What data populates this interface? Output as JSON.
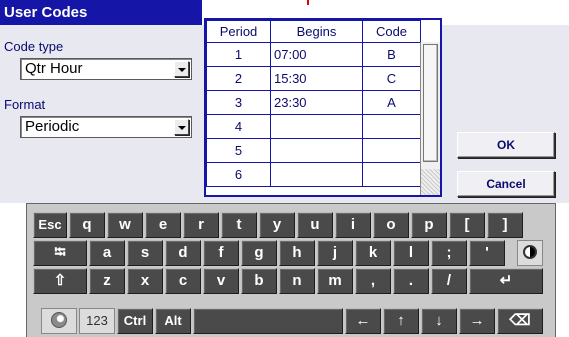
{
  "window": {
    "title": "User Codes"
  },
  "code_type": {
    "label": "Code type",
    "value": "Qtr Hour"
  },
  "format": {
    "label": "Format",
    "value": "Periodic"
  },
  "table": {
    "headers": [
      "Period",
      "Begins",
      "Code"
    ],
    "rows": [
      [
        "1",
        "07:00",
        "B"
      ],
      [
        "2",
        "15:30",
        "C"
      ],
      [
        "3",
        "23:30",
        "A"
      ],
      [
        "4",
        "",
        ""
      ],
      [
        "5",
        "",
        ""
      ],
      [
        "6",
        "",
        ""
      ]
    ]
  },
  "buttons": {
    "ok": "OK",
    "cancel": "Cancel"
  },
  "keyboard": {
    "row1": [
      "Esc",
      "q",
      "w",
      "e",
      "r",
      "t",
      "y",
      "u",
      "i",
      "o",
      "p",
      "[",
      "]"
    ],
    "row2": [
      "⭾",
      "a",
      "s",
      "d",
      "f",
      "g",
      "h",
      "j",
      "k",
      "l",
      ";",
      "'"
    ],
    "row3": [
      "⇧",
      "z",
      "x",
      "c",
      "v",
      "b",
      "n",
      "m",
      ",",
      ".",
      "/",
      "↵"
    ],
    "row4": [
      "123",
      "Ctrl",
      "Alt",
      "←",
      "↑",
      "↓",
      "→",
      "⌫"
    ],
    "icons": {
      "contrast": "contrast-icon",
      "globe": "globe-icon"
    }
  }
}
